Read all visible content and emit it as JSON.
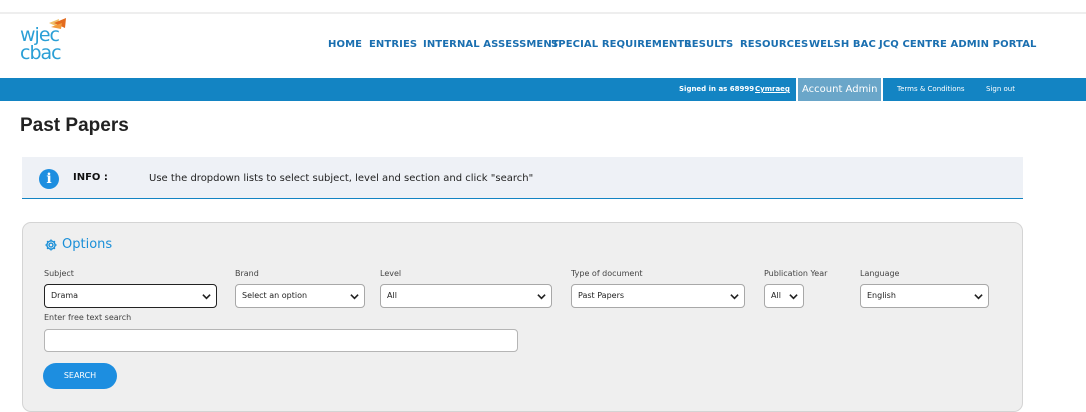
{
  "logo": {
    "line1": "wjec",
    "line2": "cbac"
  },
  "nav": {
    "items": [
      "HOME",
      "ENTRIES",
      "INTERNAL ASSESSMENT",
      "SPECIAL REQUIREMENTS",
      "RESULTS",
      "RESOURCES",
      "WELSH BAC",
      "JCQ CENTRE ADMIN PORTAL"
    ]
  },
  "account_bar": {
    "signed_in": "Signed in as 68999",
    "language_link": "Cymraeg",
    "account_admin": "Account Admin",
    "terms": "Terms & Conditions",
    "sign_out": "Sign out"
  },
  "page": {
    "title": "Past Papers"
  },
  "info": {
    "label": "INFO :",
    "text": "Use the dropdown lists to select subject, level and section and click \"search\""
  },
  "options": {
    "title": "Options",
    "subject": {
      "label": "Subject",
      "value": "Drama"
    },
    "brand": {
      "label": "Brand",
      "value": "Select an option"
    },
    "level": {
      "label": "Level",
      "value": "All"
    },
    "doc_type": {
      "label": "Type of document",
      "value": "Past Papers"
    },
    "pub_year": {
      "label": "Publication Year",
      "value": "All"
    },
    "language": {
      "label": "Language",
      "value": "English"
    },
    "free_text": {
      "label": "Enter free text search",
      "value": ""
    },
    "search_button": "SEARCH"
  },
  "colors": {
    "brand_blue": "#1384c3",
    "accent_blue": "#1d8ee0",
    "nav_text": "#1a6fb0",
    "info_bg": "#eef1f6",
    "panel_bg": "#efefef"
  }
}
